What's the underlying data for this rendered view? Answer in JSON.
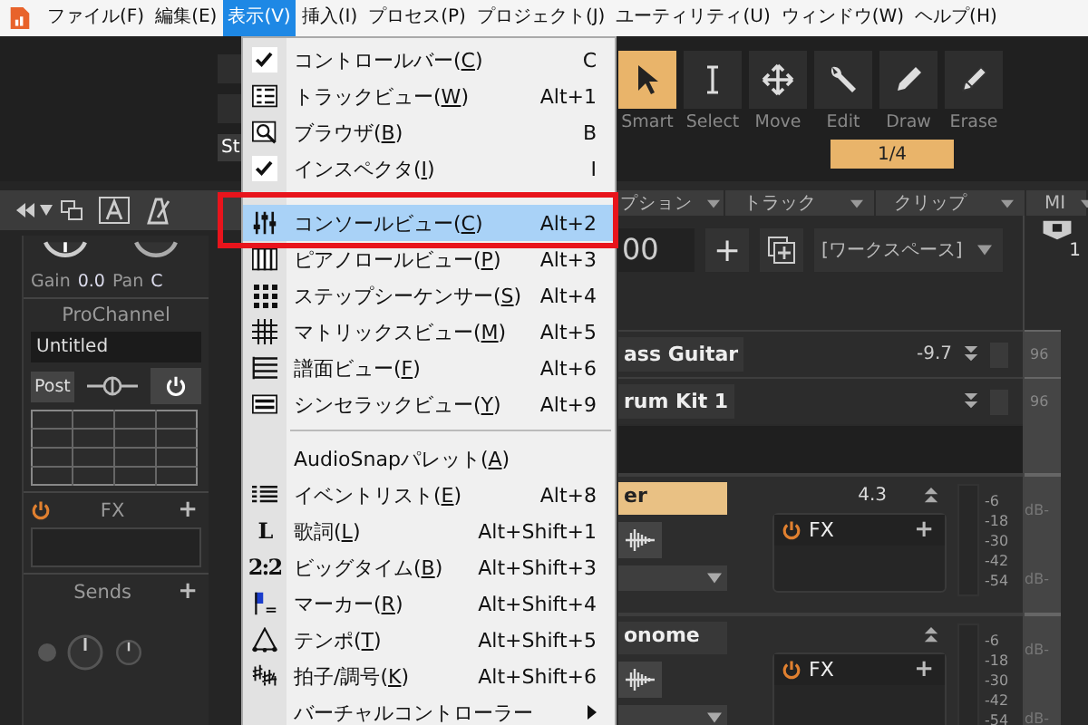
{
  "menubar": {
    "items": [
      {
        "label": "ファイル(F)",
        "selected": false
      },
      {
        "label": "編集(E)",
        "selected": false
      },
      {
        "label": "表示(V)",
        "selected": true
      },
      {
        "label": "挿入(I)",
        "selected": false
      },
      {
        "label": "プロセス(P)",
        "selected": false
      },
      {
        "label": "プロジェクト(J)",
        "selected": false
      },
      {
        "label": "ユーティリティ(U)",
        "selected": false
      },
      {
        "label": "ウィンドウ(W)",
        "selected": false
      },
      {
        "label": "ヘルプ(H)",
        "selected": false
      }
    ]
  },
  "view_menu": {
    "items": [
      {
        "kind": "check",
        "label": "コントロールバー(C)",
        "shortcut": "C",
        "checked": true,
        "selected": false
      },
      {
        "kind": "tracks",
        "label": "トラックビュー(W)",
        "shortcut": "Alt+1",
        "selected": false
      },
      {
        "kind": "browser",
        "label": "ブラウザ(B)",
        "shortcut": "B",
        "selected": false
      },
      {
        "kind": "check",
        "label": "インスペクタ(I)",
        "shortcut": "I",
        "checked": true,
        "selected": false
      },
      {
        "kind": "separator"
      },
      {
        "kind": "console",
        "label": "コンソールビュー(C)",
        "shortcut": "Alt+2",
        "selected": true
      },
      {
        "kind": "pianoroll",
        "label": "ピアノロールビュー(P)",
        "shortcut": "Alt+3",
        "selected": false
      },
      {
        "kind": "stepseq",
        "label": "ステップシーケンサー(S)",
        "shortcut": "Alt+4",
        "selected": false
      },
      {
        "kind": "matrix",
        "label": "マトリックスビュー(M)",
        "shortcut": "Alt+5",
        "selected": false
      },
      {
        "kind": "staff",
        "label": "譜面ビュー(F)",
        "shortcut": "Alt+6",
        "selected": false
      },
      {
        "kind": "rack",
        "label": "シンセラックビュー(Y)",
        "shortcut": "Alt+9",
        "selected": false
      },
      {
        "kind": "separator"
      },
      {
        "kind": "plain",
        "label": "AudioSnapパレット(A)",
        "selected": false
      },
      {
        "kind": "eventlist",
        "label": "イベントリスト(E)",
        "shortcut": "Alt+8",
        "selected": false
      },
      {
        "kind": "glyph",
        "glyph": "L",
        "label": "歌詞(L)",
        "shortcut": "Alt+Shift+1",
        "selected": false
      },
      {
        "kind": "glyph",
        "glyph": "2:2",
        "label": "ビッグタイム(B)",
        "shortcut": "Alt+Shift+3",
        "selected": false
      },
      {
        "kind": "marker",
        "label": "マーカー(R)",
        "shortcut": "Alt+Shift+4",
        "selected": false
      },
      {
        "kind": "tempo",
        "label": "テンポ(T)",
        "shortcut": "Alt+Shift+5",
        "selected": false
      },
      {
        "kind": "meter",
        "label": "拍子/調号(K)",
        "shortcut": "Alt+Shift+6",
        "selected": false
      },
      {
        "kind": "submenu",
        "label": "バーチャルコントローラー",
        "selected": false
      }
    ]
  },
  "toolbar": {
    "side_label": "St",
    "snap": "1/4",
    "tools": [
      {
        "label": "Smart",
        "selected": true
      },
      {
        "label": "Select",
        "selected": false
      },
      {
        "label": "Move",
        "selected": false
      },
      {
        "label": "Edit",
        "selected": false
      },
      {
        "label": "Draw",
        "selected": false
      },
      {
        "label": "Erase",
        "selected": false
      }
    ]
  },
  "inspector": {
    "gain_label": "Gain",
    "gain_value": "0.0",
    "pan_label": "Pan",
    "pan_value": "C",
    "prochannel_title": "ProChannel",
    "preset": "Untitled",
    "post_button": "Post",
    "fx_title": "FX",
    "fx_add": "+",
    "sends_title": "Sends",
    "sends_add": "+"
  },
  "track_view": {
    "tabs": [
      "プション",
      "トラック",
      "クリップ",
      "MI"
    ],
    "zoom_value": "00",
    "add_button": "+",
    "workspace": "[ワークスペース]",
    "timeline_marker": "1",
    "tracks": [
      {
        "name": "ass Guitar",
        "value": "-9.7",
        "ruler": "96"
      },
      {
        "name": "rum Kit 1",
        "ruler": "96"
      }
    ],
    "strips": [
      {
        "name": "er",
        "selected": true,
        "value": "4.3",
        "fx": "FX",
        "fx_add": "+",
        "scale": [
          "-6",
          "-18",
          "-30",
          "-42",
          "-54"
        ],
        "db": [
          "dB-",
          "dB-"
        ]
      },
      {
        "name": "onome",
        "selected": false,
        "fx": "FX",
        "fx_add": "+",
        "scale": [
          "-6",
          "-18",
          "-30",
          "-42",
          "-54"
        ],
        "db": [
          "dB-",
          "dB-"
        ]
      }
    ]
  }
}
